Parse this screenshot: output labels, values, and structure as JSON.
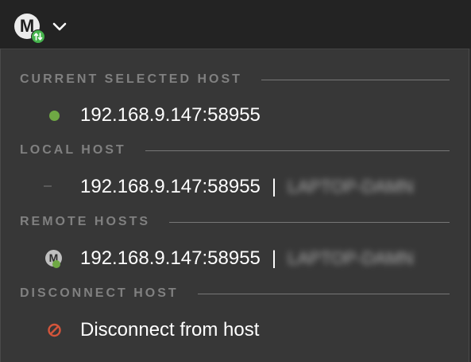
{
  "toolbar": {
    "logo_letter": "M",
    "icons": {
      "logo": "multi-user-logo-icon",
      "badge": "sync-arrows-icon",
      "chevron": "chevron-down-icon"
    }
  },
  "sections": {
    "current": {
      "title": "CURRENT SELECTED HOST",
      "host": "192.168.9.147:58955",
      "status_color": "#6fa844"
    },
    "local": {
      "title": "LOCAL HOST",
      "host": "192.168.9.147:58955",
      "separator": "|",
      "machine_name": "LAPTOP-DAMN"
    },
    "remote": {
      "title": "REMOTE HOSTS",
      "host": "192.168.9.147:58955",
      "separator": "|",
      "machine_name": "LAPTOP-DAMN",
      "icon_letter": "M"
    },
    "disconnect": {
      "title": "DISCONNECT HOST",
      "action_label": "Disconnect from host",
      "icon_color": "#d4553b"
    }
  }
}
